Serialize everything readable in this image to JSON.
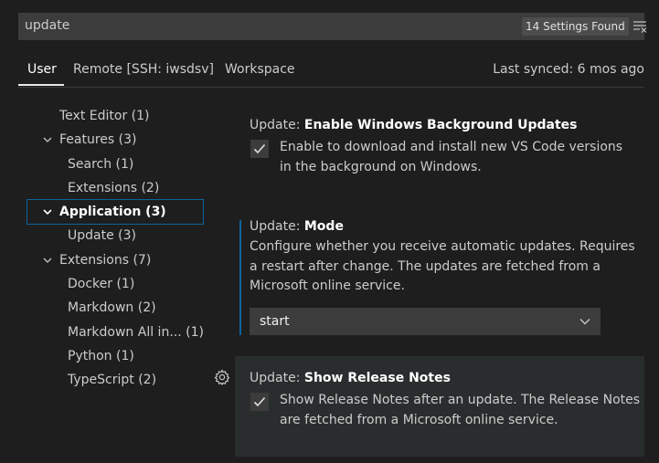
{
  "search": {
    "value": "update",
    "found_badge": "14 Settings Found"
  },
  "tabs": [
    {
      "label": "User"
    },
    {
      "label": "Remote [SSH: iwsdsv]"
    },
    {
      "label": "Workspace"
    }
  ],
  "last_synced": "Last synced: 6 mos ago",
  "toc": [
    {
      "label": "Text Editor (1)"
    },
    {
      "label": "Features (3)"
    },
    {
      "label": "Search (1)"
    },
    {
      "label": "Extensions (2)"
    },
    {
      "label": "Application (3)"
    },
    {
      "label": "Update (3)"
    },
    {
      "label": "Extensions (7)"
    },
    {
      "label": "Docker (1)"
    },
    {
      "label": "Markdown (2)"
    },
    {
      "label": "Markdown All in... (1)"
    },
    {
      "label": "Python (1)"
    },
    {
      "label": "TypeScript (2)"
    }
  ],
  "settings": {
    "background_updates": {
      "category": "Update: ",
      "name": "Enable Windows Background Updates",
      "desc_line1": "Enable to download and install new VS Code versions",
      "desc_line2": "in the background on Windows.",
      "checked": true
    },
    "mode": {
      "category": "Update: ",
      "name": "Mode",
      "desc_line1": "Configure whether you receive automatic updates. Requires",
      "desc_line2": "a restart after change. The updates are fetched from a",
      "desc_line3": "Microsoft online service.",
      "value": "start"
    },
    "release_notes": {
      "category": "Update: ",
      "name": "Show Release Notes",
      "desc_line1": "Show Release Notes after an update. The Release Notes",
      "desc_line2": "are fetched from a Microsoft online service.",
      "checked": true
    }
  },
  "colors": {
    "accent": "#0e639c",
    "background": "#1e1e1e",
    "input": "#3c3c3c"
  },
  "icons": {
    "clear": "clear-all-icon",
    "gear": "gear-icon",
    "chevron": "chevron-down-icon",
    "check": "check-icon"
  }
}
